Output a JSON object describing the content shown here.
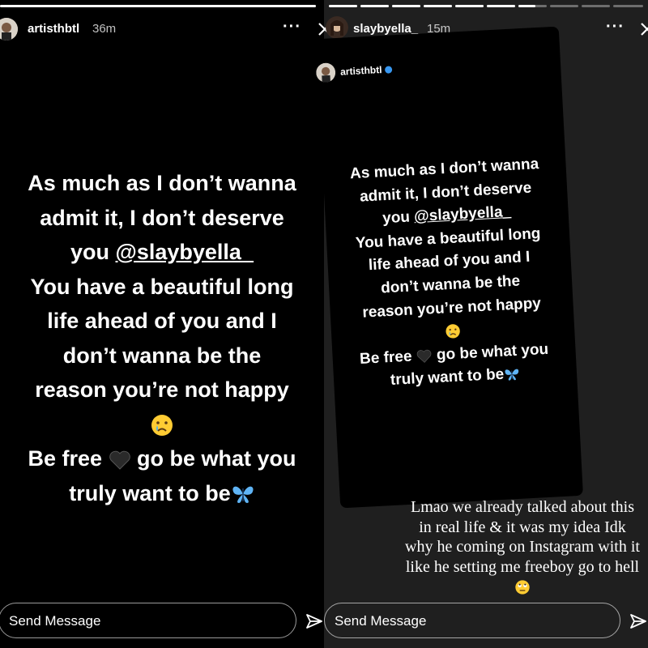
{
  "left_story": {
    "username": "artisthbtl",
    "time": "36m",
    "more_label": "···",
    "lines": [
      "As much as I don’t wanna",
      "admit it, I don’t deserve",
      "you ",
      "You have a beautiful long",
      "life ahead of you and I",
      "don’t wanna be the",
      "reason you’re not happy",
      "",
      "Be free",
      " go be what you",
      "truly want to be"
    ],
    "mention": "@slaybyella_",
    "send_message_placeholder": "Send Message"
  },
  "right_story": {
    "username": "slaybyella_",
    "time": "15m",
    "more_label": "···",
    "reshared": {
      "username": "artisthbtl",
      "lines": [
        "As much as I don’t wanna",
        "admit it, I don’t deserve",
        "you ",
        "You have a beautiful long",
        "life ahead of you and I",
        "don’t wanna be the",
        "reason you’re not happy",
        "",
        "Be free",
        " go be what you",
        "truly want to be"
      ],
      "mention": "@slaybyella_"
    },
    "reply_text": "Lmao we already talked about this in real life & it was my idea Idk why he coming on Instagram with it like he setting me freeboy go to hell",
    "send_message_placeholder": "Send Message"
  },
  "colors": {
    "background": "#000000",
    "right_background": "#1f1f1f",
    "verified_badge": "#3897f0",
    "butterfly": "#5fb4f5"
  },
  "icons": [
    "close-icon",
    "send-icon",
    "more-icon",
    "crying-emoji-icon",
    "black-heart-icon",
    "butterfly-icon",
    "eye-roll-emoji-icon",
    "verified-icon"
  ]
}
